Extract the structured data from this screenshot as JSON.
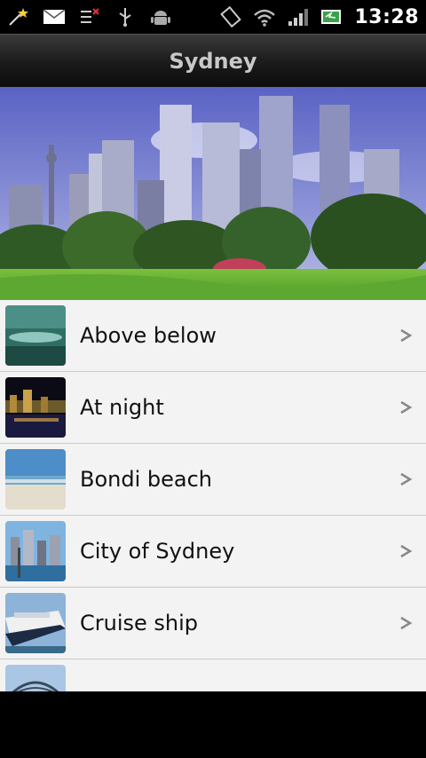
{
  "status": {
    "time": "13:28",
    "icons": [
      "magic-wand-icon",
      "mail-icon",
      "debug-icon",
      "usb-icon",
      "android-icon",
      "rotate-icon",
      "wifi-icon",
      "signal-icon",
      "battery-icon"
    ]
  },
  "header": {
    "title": "Sydney"
  },
  "list": {
    "items": [
      {
        "label": "Above below"
      },
      {
        "label": "At night"
      },
      {
        "label": "Bondi beach"
      },
      {
        "label": "City of Sydney"
      },
      {
        "label": "Cruise ship"
      },
      {
        "label": ""
      }
    ]
  },
  "colors": {
    "list_bg": "#f3f3f3",
    "divider": "#c9c9c9",
    "header_text": "#c8c8c8"
  }
}
